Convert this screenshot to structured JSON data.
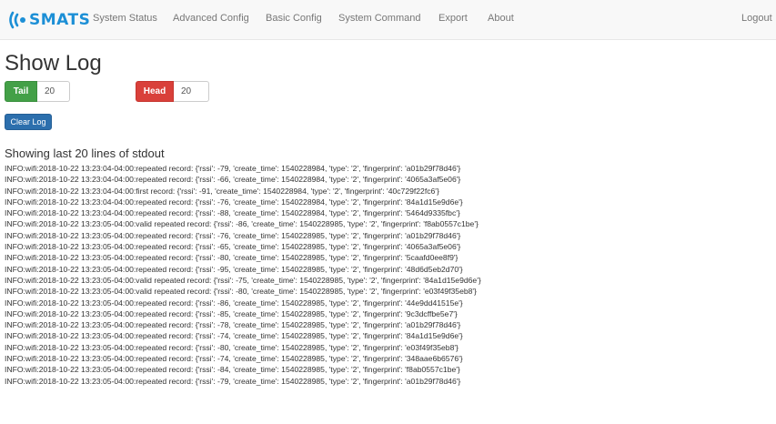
{
  "brand": {
    "logo_text": "SMATS",
    "logo_icon": "smats-wave-icon"
  },
  "nav": {
    "items": [
      {
        "label": "System Status"
      },
      {
        "label": "Advanced Config"
      },
      {
        "label": "Basic Config"
      },
      {
        "label": "System Command"
      },
      {
        "label": "Export"
      },
      {
        "label": "About"
      }
    ],
    "logout_label": "Logout"
  },
  "page_title": "Show Log",
  "controls": {
    "tail_label": "Tail",
    "tail_value": "20",
    "head_label": "Head",
    "head_value": "20",
    "clear_label": "Clear Log"
  },
  "colors": {
    "tail": "#43a047",
    "head": "#d9403a",
    "clear": "#2c6fad",
    "brand": "#1c8fd6"
  },
  "log": {
    "heading": "Showing last 20 lines of stdout",
    "lines": [
      "INFO:wifi:2018-10-22 13:23:04-04:00:repeated record: {'rssi': -79, 'create_time': 1540228984, 'type': '2', 'fingerprint': 'a01b29f78d46'}",
      "INFO:wifi:2018-10-22 13:23:04-04:00:repeated record: {'rssi': -66, 'create_time': 1540228984, 'type': '2', 'fingerprint': '4065a3af5e06'}",
      "INFO:wifi:2018-10-22 13:23:04-04:00:first record: {'rssi': -91, 'create_time': 1540228984, 'type': '2', 'fingerprint': '40c729f22fc6'}",
      "INFO:wifi:2018-10-22 13:23:04-04:00:repeated record: {'rssi': -76, 'create_time': 1540228984, 'type': '2', 'fingerprint': '84a1d15e9d6e'}",
      "INFO:wifi:2018-10-22 13:23:04-04:00:repeated record: {'rssi': -88, 'create_time': 1540228984, 'type': '2', 'fingerprint': '5464d9335fbc'}",
      "INFO:wifi:2018-10-22 13:23:05-04:00:valid repeated record: {'rssi': -86, 'create_time': 1540228985, 'type': '2', 'fingerprint': 'f8ab0557c1be'}",
      "INFO:wifi:2018-10-22 13:23:05-04:00:repeated record: {'rssi': -76, 'create_time': 1540228985, 'type': '2', 'fingerprint': 'a01b29f78d46'}",
      "INFO:wifi:2018-10-22 13:23:05-04:00:repeated record: {'rssi': -65, 'create_time': 1540228985, 'type': '2', 'fingerprint': '4065a3af5e06'}",
      "INFO:wifi:2018-10-22 13:23:05-04:00:repeated record: {'rssi': -80, 'create_time': 1540228985, 'type': '2', 'fingerprint': '5caafd0ee8f9'}",
      "INFO:wifi:2018-10-22 13:23:05-04:00:repeated record: {'rssi': -95, 'create_time': 1540228985, 'type': '2', 'fingerprint': '48d6d5eb2d70'}",
      "INFO:wifi:2018-10-22 13:23:05-04:00:valid repeated record: {'rssi': -75, 'create_time': 1540228985, 'type': '2', 'fingerprint': '84a1d15e9d6e'}",
      "INFO:wifi:2018-10-22 13:23:05-04:00:valid repeated record: {'rssi': -80, 'create_time': 1540228985, 'type': '2', 'fingerprint': 'e03f49f35eb8'}",
      "INFO:wifi:2018-10-22 13:23:05-04:00:repeated record: {'rssi': -86, 'create_time': 1540228985, 'type': '2', 'fingerprint': '44e9dd41515e'}",
      "INFO:wifi:2018-10-22 13:23:05-04:00:repeated record: {'rssi': -85, 'create_time': 1540228985, 'type': '2', 'fingerprint': '9c3dcffbe5e7'}",
      "INFO:wifi:2018-10-22 13:23:05-04:00:repeated record: {'rssi': -78, 'create_time': 1540228985, 'type': '2', 'fingerprint': 'a01b29f78d46'}",
      "INFO:wifi:2018-10-22 13:23:05-04:00:repeated record: {'rssi': -74, 'create_time': 1540228985, 'type': '2', 'fingerprint': '84a1d15e9d6e'}",
      "INFO:wifi:2018-10-22 13:23:05-04:00:repeated record: {'rssi': -80, 'create_time': 1540228985, 'type': '2', 'fingerprint': 'e03f49f35eb8'}",
      "INFO:wifi:2018-10-22 13:23:05-04:00:repeated record: {'rssi': -74, 'create_time': 1540228985, 'type': '2', 'fingerprint': '348aae6b6576'}",
      "INFO:wifi:2018-10-22 13:23:05-04:00:repeated record: {'rssi': -84, 'create_time': 1540228985, 'type': '2', 'fingerprint': 'f8ab0557c1be'}",
      "INFO:wifi:2018-10-22 13:23:05-04:00:repeated record: {'rssi': -79, 'create_time': 1540228985, 'type': '2', 'fingerprint': 'a01b29f78d46'}"
    ]
  }
}
